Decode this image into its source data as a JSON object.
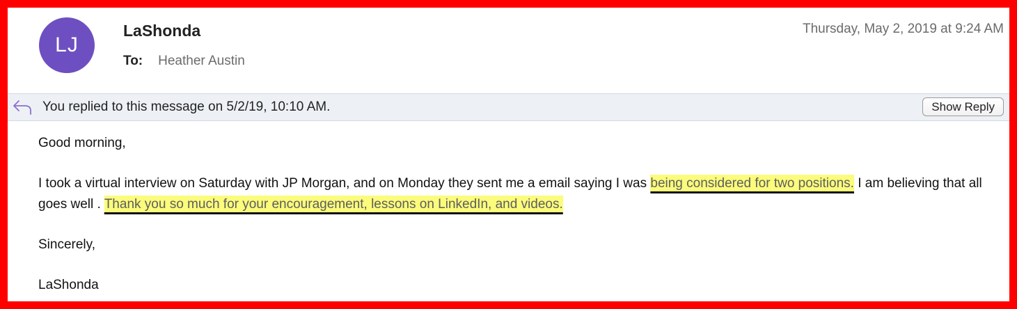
{
  "header": {
    "avatar_initials": "LJ",
    "sender_name": "LaShonda",
    "to_label": "To:",
    "recipient": "Heather Austin",
    "datetime": "Thursday, May 2, 2019 at 9:24 AM"
  },
  "banner": {
    "icon": "reply-arrow-icon",
    "text": "You replied to this message on 5/2/19, 10:10 AM.",
    "show_reply_label": "Show Reply"
  },
  "message": {
    "greeting": "Good morning,",
    "body_part1": "I took a virtual interview on Saturday with JP Morgan, and on Monday they sent me a email saying I was ",
    "highlight1": "being considered for two positions.",
    "body_part2": " I am believing that all goes well . ",
    "highlight2": "Thank you so much for your encouragement, lessons on LinkedIn, and videos.",
    "closing": "Sincerely,",
    "signature": "LaShonda"
  },
  "colors": {
    "frame_border": "#ff0000",
    "avatar_bg": "#6e4fc1",
    "highlight": "#fbfb7c",
    "banner_bg": "#edf0f5"
  }
}
